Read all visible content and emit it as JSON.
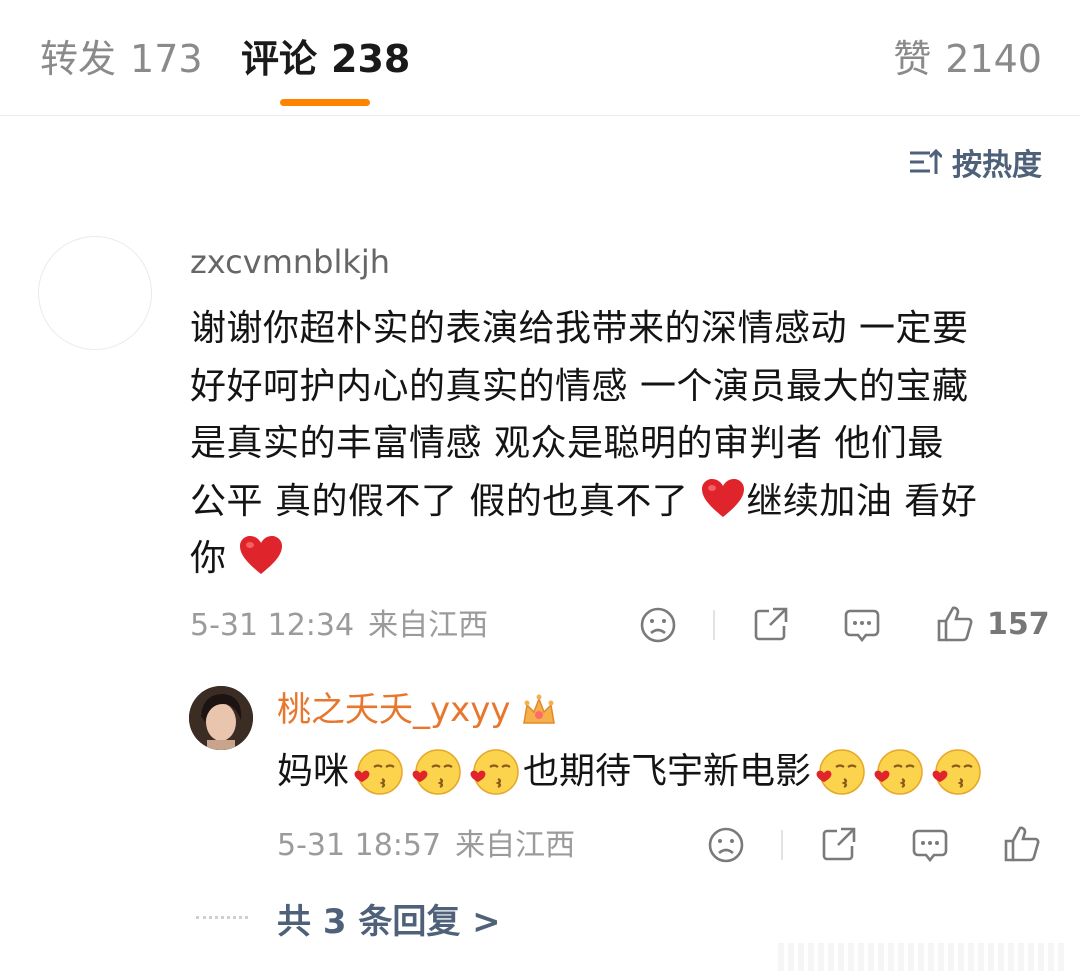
{
  "tabs": {
    "repost": {
      "label": "转发",
      "count": "173"
    },
    "comment": {
      "label": "评论",
      "count": "238"
    },
    "like": {
      "label": "赞",
      "count": "2140"
    }
  },
  "sort": {
    "label": "按热度",
    "icon": "sort-icon"
  },
  "comment": {
    "username": "zxcvmnblkjh",
    "lines": [
      "谢谢你超朴实的表演给我带来的深情感动 一定要",
      "好好呵护内心的真实的情感 一个演员最大的宝藏",
      "是真实的丰富情感  观众是聪明的审判者 他们最",
      "公平 真的假不了 假的也真不了",
      "继续加油 看好",
      "你"
    ],
    "time": "5-31 12:34",
    "location": "来自江西",
    "like_count": "157"
  },
  "reply": {
    "username": "桃之夭夭_yxyy",
    "text_start": "妈咪",
    "text_middle": "也期待飞宇新电影",
    "time": "5-31 18:57",
    "location": "来自江西"
  },
  "more_replies": {
    "label": "共 3 条回复 >"
  },
  "colors": {
    "accent": "#ff8200",
    "link": "#4f6179",
    "reply_name": "#e8772e",
    "heart": "#e0242b"
  }
}
